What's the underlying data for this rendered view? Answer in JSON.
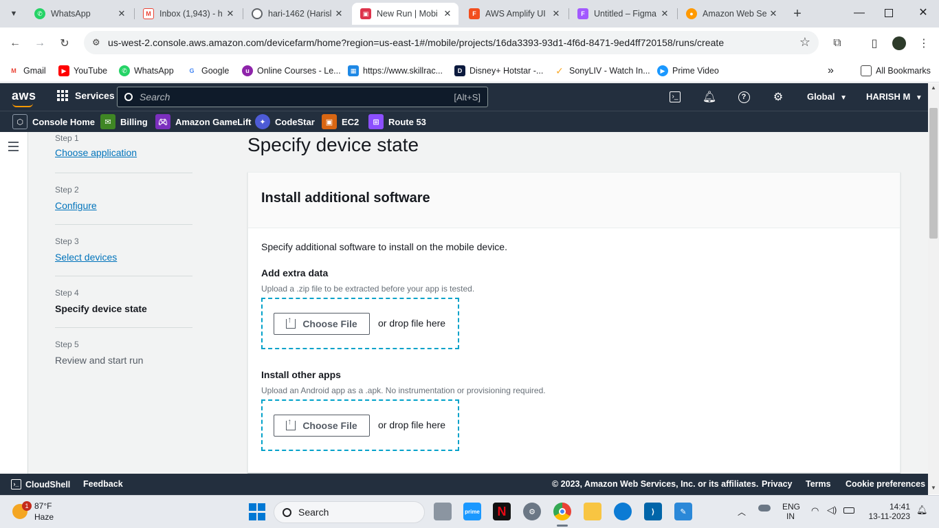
{
  "browser": {
    "tabs": [
      {
        "title": "WhatsApp",
        "icon": "whatsapp-icon",
        "color": "#25d366",
        "active": false
      },
      {
        "title": "Inbox (1,943) - h",
        "icon": "gmail-icon",
        "color": "#ea4335",
        "active": false
      },
      {
        "title": "hari-1462 (Harisl",
        "icon": "github-icon",
        "color": "#5f6368",
        "active": false
      },
      {
        "title": "New Run | Mobi",
        "icon": "aws-devicefarm-icon",
        "color": "#dd344c",
        "active": true
      },
      {
        "title": "AWS Amplify UI",
        "icon": "figma-icon",
        "color": "#f24e1e",
        "active": false
      },
      {
        "title": "Untitled – Figma",
        "icon": "figma-icon",
        "color": "#a259ff",
        "active": false
      },
      {
        "title": "Amazon Web Se",
        "icon": "aws-icon",
        "color": "#ff9900",
        "active": false
      }
    ],
    "url": "us-west-2.console.aws.amazon.com/devicefarm/home?region=us-east-1#/mobile/projects/16da3393-93d1-4f6d-8471-9ed4ff720158/runs/create",
    "bookmarks": [
      {
        "label": "Gmail",
        "color": "#ea4335"
      },
      {
        "label": "YouTube",
        "color": "#ff0000"
      },
      {
        "label": "WhatsApp",
        "color": "#25d366"
      },
      {
        "label": "Google",
        "color": "#4285f4"
      },
      {
        "label": "Online Courses - Le...",
        "color": "#8e24aa"
      },
      {
        "label": "https://www.skillrac...",
        "color": "#1e88e5"
      },
      {
        "label": "Disney+ Hotstar -...",
        "color": "#0c1a3e"
      },
      {
        "label": "SonyLIV - Watch In...",
        "color": "#f9a825"
      },
      {
        "label": "Prime Video",
        "color": "#1a98ff"
      }
    ],
    "all_bookmarks": "All Bookmarks"
  },
  "aws": {
    "logo": "aws",
    "services": "Services",
    "search_placeholder": "Search",
    "search_shortcut": "[Alt+S]",
    "region": "Global",
    "user": "HARISH M",
    "favorites": [
      {
        "label": "Console Home",
        "icon": "cube-icon",
        "color": "#545b64"
      },
      {
        "label": "Billing",
        "icon": "billing-icon",
        "color": "#3f8624"
      },
      {
        "label": "Amazon GameLift",
        "icon": "gamelift-icon",
        "color": "#7b2fbe"
      },
      {
        "label": "CodeStar",
        "icon": "codestar-icon",
        "color": "#4d5bd6"
      },
      {
        "label": "EC2",
        "icon": "ec2-icon",
        "color": "#d86613"
      },
      {
        "label": "Route 53",
        "icon": "route53-icon",
        "color": "#8c4fff"
      }
    ]
  },
  "wizard": {
    "steps": [
      {
        "num": "Step 1",
        "label": "Choose application",
        "state": "link"
      },
      {
        "num": "Step 2",
        "label": "Configure",
        "state": "link"
      },
      {
        "num": "Step 3",
        "label": "Select devices",
        "state": "link"
      },
      {
        "num": "Step 4",
        "label": "Specify device state",
        "state": "current"
      },
      {
        "num": "Step 5",
        "label": "Review and start run",
        "state": "disabled"
      }
    ]
  },
  "main": {
    "page_title": "Specify device state",
    "panel_title": "Install additional software",
    "panel_description": "Specify additional software to install on the mobile device.",
    "extra_data": {
      "label": "Add extra data",
      "hint": "Upload a .zip file to be extracted before your app is tested.",
      "button": "Choose File",
      "drop": "or drop file here"
    },
    "other_apps": {
      "label": "Install other apps",
      "hint": "Upload an Android app as a .apk. No instrumentation or provisioning required.",
      "button": "Choose File",
      "drop": "or drop file here"
    }
  },
  "footer": {
    "cloudshell": "CloudShell",
    "feedback": "Feedback",
    "copyright": "© 2023, Amazon Web Services, Inc. or its affiliates.",
    "privacy": "Privacy",
    "terms": "Terms",
    "cookies": "Cookie preferences"
  },
  "taskbar": {
    "weather_temp": "87°F",
    "weather_desc": "Haze",
    "notification_count": "1",
    "search": "Search",
    "lang": "ENG",
    "region": "IN",
    "time": "14:41",
    "date": "13-11-2023"
  },
  "colors": {
    "aws_nav": "#232f3e",
    "aws_orange": "#ff9900",
    "link": "#0073bb",
    "dropzone_border": "#00a1c9"
  }
}
